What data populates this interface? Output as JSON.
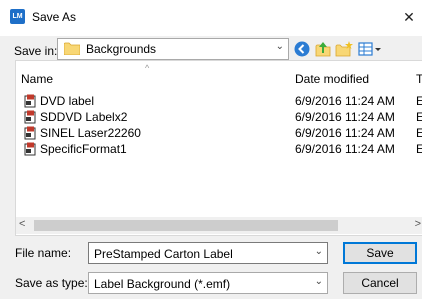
{
  "window": {
    "title": "Save As",
    "app_icon_text": "LM",
    "close_glyph": "✕"
  },
  "toolbar": {
    "save_in_label": "Save in:",
    "save_in_value": "Backgrounds",
    "icons": [
      "back-icon",
      "up-folder-icon",
      "new-folder-icon",
      "view-menu-icon"
    ]
  },
  "file_list": {
    "columns": {
      "name": "Name",
      "date_modified": "Date modified",
      "type": "Ty"
    },
    "files": [
      {
        "name": "DVD label",
        "date": "6/9/2016 11:24 AM",
        "type": "E"
      },
      {
        "name": "SDDVD Labelx2",
        "date": "6/9/2016 11:24 AM",
        "type": "E"
      },
      {
        "name": "SINEL Laser22260",
        "date": "6/9/2016 11:24 AM",
        "type": "E"
      },
      {
        "name": "SpecificFormat1",
        "date": "6/9/2016 11:24 AM",
        "type": "E"
      }
    ]
  },
  "file_name": {
    "label": "File name:",
    "value": "PreStamped Carton Label"
  },
  "save_as_type": {
    "label": "Save as type:",
    "value": "Label Background (*.emf)"
  },
  "buttons": {
    "save": "Save",
    "cancel": "Cancel"
  },
  "colors": {
    "accent": "#0078d7",
    "folder": "#f8d775",
    "app_icon": "#1e6fc8"
  }
}
